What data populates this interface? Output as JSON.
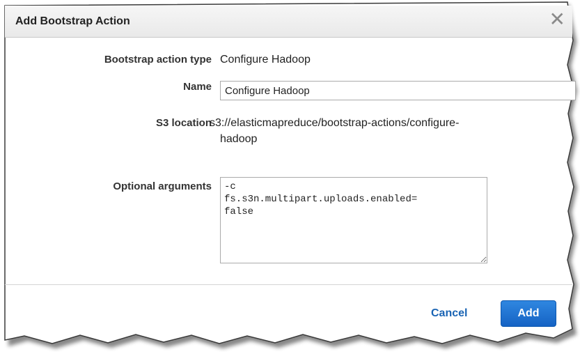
{
  "dialog": {
    "title": "Add Bootstrap Action",
    "close_icon": "close-icon"
  },
  "form": {
    "action_type_label": "Bootstrap action type",
    "action_type_value": "Configure Hadoop",
    "name_label": "Name",
    "name_value": "Configure Hadoop",
    "s3_label": "S3 location",
    "s3_value_line1": "s3://elasticmapreduce/bootstrap-actions/configure-",
    "s3_value_line2": "hadoop",
    "args_label": "Optional arguments",
    "args_value": "-c\nfs.s3n.multipart.uploads.enabled=\nfalse"
  },
  "footer": {
    "cancel_label": "Cancel",
    "add_label": "Add"
  },
  "colors": {
    "link": "#1a64b4",
    "primary_button": "#1f74d4"
  }
}
